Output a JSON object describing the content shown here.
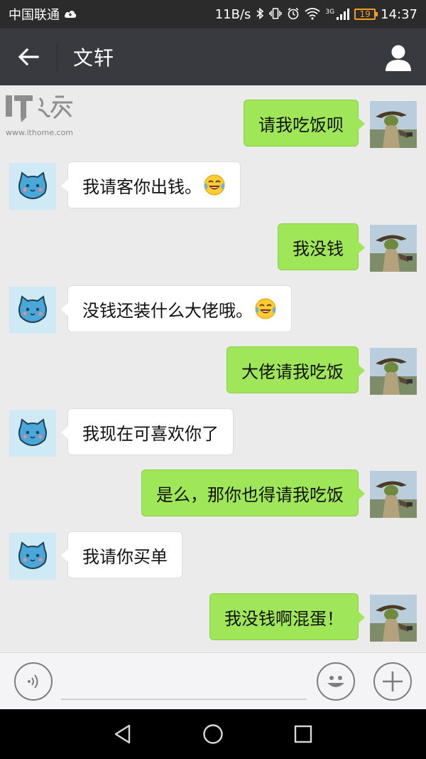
{
  "status_bar": {
    "carrier": "中国联通",
    "net_speed": "11B/s",
    "network_type": "3G",
    "battery": "19",
    "time": "14:37"
  },
  "header": {
    "title": "文轩",
    "back_icon": "back-arrow-icon",
    "profile_icon": "person-icon"
  },
  "watermark": {
    "logo": "IT之家",
    "url": "www.ithome.com"
  },
  "messages": [
    {
      "sender": "me",
      "text": "请我吃饭呗",
      "emoji": ""
    },
    {
      "sender": "other",
      "text": "我请客你出钱。",
      "emoji": "laughing-tears-emoji"
    },
    {
      "sender": "me",
      "text": "我没钱",
      "emoji": ""
    },
    {
      "sender": "other",
      "text": "没钱还装什么大佬哦。",
      "emoji": "laughing-tears-emoji"
    },
    {
      "sender": "me",
      "text": "大佬请我吃饭",
      "emoji": ""
    },
    {
      "sender": "other",
      "text": "我现在可喜欢你了",
      "emoji": ""
    },
    {
      "sender": "me",
      "text": "是么，那你也得请我吃饭",
      "emoji": ""
    },
    {
      "sender": "other",
      "text": "我请你买单",
      "emoji": ""
    },
    {
      "sender": "me",
      "text": "我没钱啊混蛋！",
      "emoji": ""
    }
  ],
  "input_bar": {
    "placeholder": "",
    "value": ""
  },
  "colors": {
    "my_bubble": "#9fe658",
    "other_bubble": "#ffffff",
    "header_bg": "#393a3f",
    "chat_bg": "#ebebeb"
  }
}
